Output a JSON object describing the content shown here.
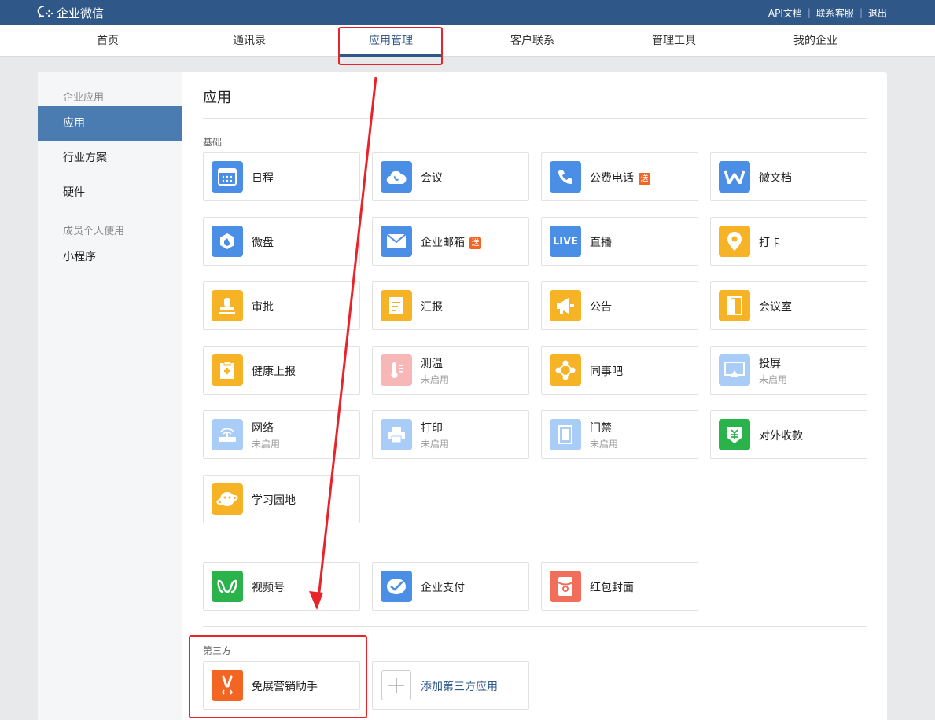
{
  "header": {
    "logo_text": "企业微信",
    "links": [
      "API文档",
      "联系客服",
      "退出"
    ],
    "separator": "|"
  },
  "nav": {
    "tabs": [
      "首页",
      "通讯录",
      "应用管理",
      "客户联系",
      "管理工具",
      "我的企业"
    ],
    "active": "应用管理"
  },
  "sidebar": {
    "group1": "企业应用",
    "items1": [
      "应用",
      "行业方案",
      "硬件"
    ],
    "group2": "成员个人使用",
    "items2": [
      "小程序"
    ],
    "active": "应用"
  },
  "main": {
    "title": "应用",
    "basic_label": "基础",
    "third_label": "第三方",
    "badge_text": "送",
    "disabled_text": "未启用",
    "apps": {
      "schedule": "日程",
      "meeting": "会议",
      "phone": "公费电话",
      "doc": "微文档",
      "drive": "微盘",
      "mail": "企业邮箱",
      "live": "直播",
      "live_icon_text": "LIVE",
      "checkin": "打卡",
      "approval": "审批",
      "report": "汇报",
      "notice": "公告",
      "room": "会议室",
      "health": "健康上报",
      "temp": "测温",
      "bar": "同事吧",
      "cast": "投屏",
      "network": "网络",
      "print": "打印",
      "door": "门禁",
      "pay_out": "对外收款",
      "learn": "学习园地",
      "channels": "视频号",
      "paycorp": "企业支付",
      "redpacket": "红包封面",
      "rabbit": "免展营销助手",
      "add_third": "添加第三方应用"
    }
  },
  "colors": {
    "topbar": "#2f5889",
    "blue_icon": "#4a8fe5",
    "yellow_icon": "#f5b325",
    "green_icon": "#2ab24b",
    "red_icon": "#f06e5a",
    "annotation": "#e8242b"
  }
}
